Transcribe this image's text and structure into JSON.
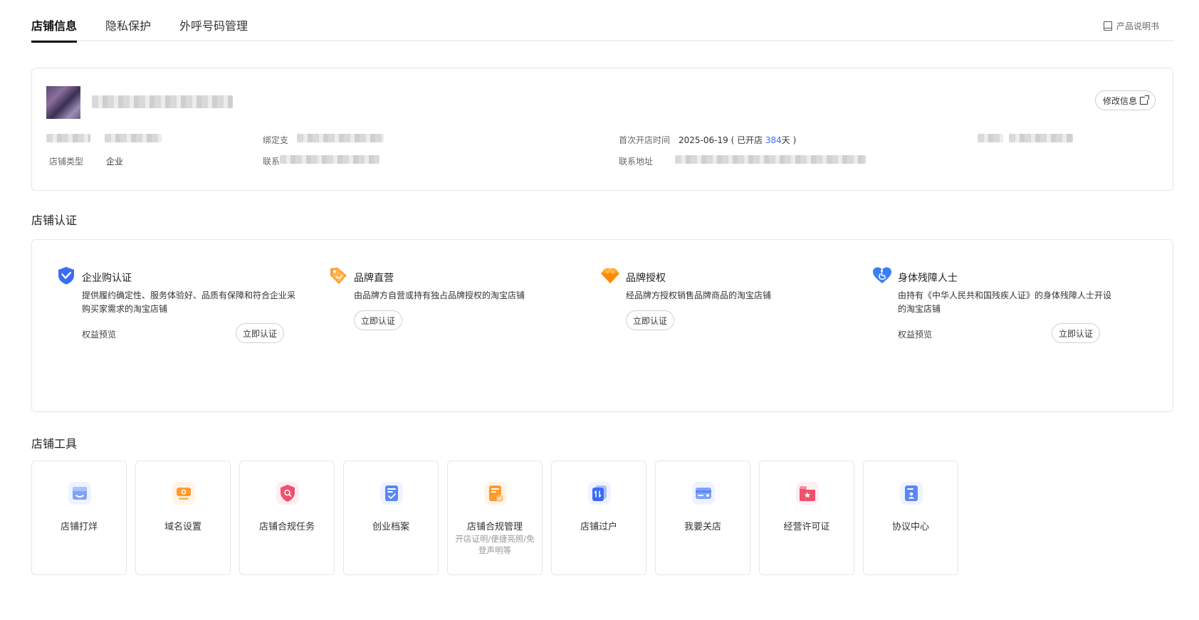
{
  "tabs": [
    {
      "label": "店铺信息",
      "active": true
    },
    {
      "label": "隐私保护",
      "active": false
    },
    {
      "label": "外呼号码管理",
      "active": false
    }
  ],
  "manual_label": "产品说明书",
  "store_info": {
    "edit_button": "修改信息",
    "binding_label": "绑定支",
    "first_open_label": "首次开店时间",
    "first_open_date": "2025-06-19",
    "open_prefix": "( 已开店 ",
    "open_days": "384",
    "open_suffix": "天 )",
    "store_type_label": "店铺类型",
    "store_type_value": "企业",
    "contact_label": "联系",
    "address_label": "联系地址"
  },
  "cert_section": {
    "title": "店铺认证",
    "items": [
      {
        "icon": "verified-shield-icon",
        "title": "企业购认证",
        "desc": "提供履约确定性、服务体验好、品质有保障和符合企业采购买家需求的淘宝店铺",
        "benefit": "权益预览",
        "button": "立即认证"
      },
      {
        "icon": "tag-icon",
        "title": "品牌直营",
        "desc": "由品牌方自营或持有独占品牌授权的淘宝店铺",
        "benefit": "",
        "button": "立即认证"
      },
      {
        "icon": "diamond-icon",
        "title": "品牌授权",
        "desc": "经品牌方授权销售品牌商品的淘宝店铺",
        "benefit": "",
        "button": "立即认证"
      },
      {
        "icon": "accessibility-heart-icon",
        "title": "身体残障人士",
        "desc": "由持有《中华人民共和国残疾人证》的身体残障人士开设的淘宝店铺",
        "benefit": "权益预览",
        "button": "立即认证"
      }
    ]
  },
  "tools_section": {
    "title": "店铺工具",
    "items": [
      {
        "label": "店铺打烊",
        "sub": "",
        "icon": "store-close-icon"
      },
      {
        "label": "域名设置",
        "sub": "",
        "icon": "domain-icon"
      },
      {
        "label": "店铺合规任务",
        "sub": "",
        "icon": "compliance-shield-icon"
      },
      {
        "label": "创业档案",
        "sub": "",
        "icon": "archive-icon"
      },
      {
        "label": "店铺合规管理",
        "sub": "开店证明/便捷亮照/免登声明等",
        "icon": "compliance-doc-icon"
      },
      {
        "label": "店铺过户",
        "sub": "",
        "icon": "transfer-icon"
      },
      {
        "label": "我要关店",
        "sub": "",
        "icon": "close-store-icon"
      },
      {
        "label": "经营许可证",
        "sub": "",
        "icon": "license-icon"
      },
      {
        "label": "协议中心",
        "sub": "",
        "icon": "agreement-icon"
      }
    ]
  },
  "colors": {
    "accent_blue": "#3b6cf6",
    "orange": "#ff9a2e",
    "pink": "#f0506e"
  }
}
